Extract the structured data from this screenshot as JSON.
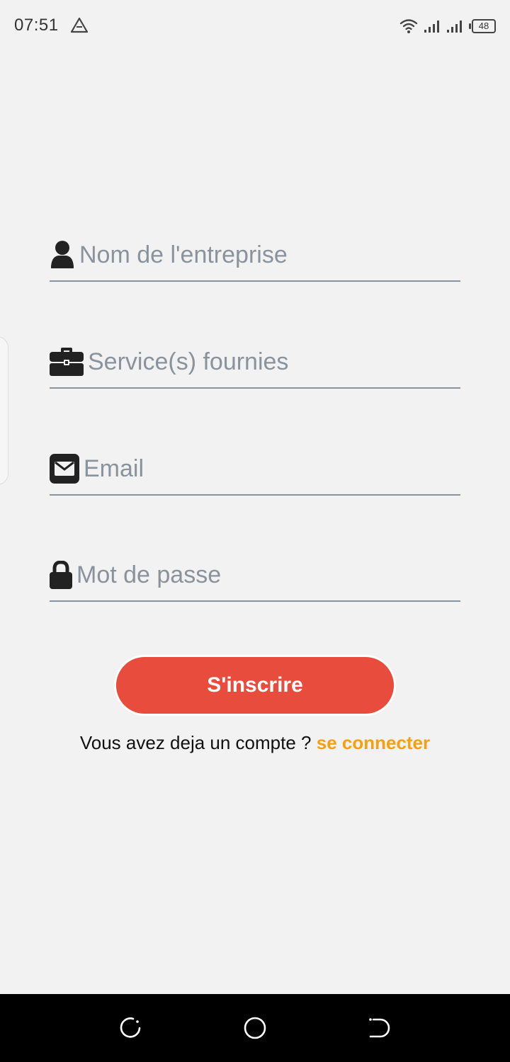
{
  "status_bar": {
    "time": "07:51",
    "battery": "48",
    "icons": [
      "warning-triangle-icon",
      "wifi-icon",
      "signal-icon",
      "signal-icon",
      "battery-icon"
    ]
  },
  "form": {
    "fields": [
      {
        "icon": "user-icon",
        "placeholder": "Nom de l'entreprise",
        "value": ""
      },
      {
        "icon": "briefcase-icon",
        "placeholder": "Service(s) fournies",
        "value": ""
      },
      {
        "icon": "envelope-icon",
        "placeholder": "Email",
        "value": ""
      },
      {
        "icon": "lock-icon",
        "placeholder": "Mot de passe",
        "value": ""
      }
    ],
    "submit_label": "S'inscrire",
    "login_prompt": "Vous avez deja un compte ? ",
    "login_link": "se connecter"
  },
  "colors": {
    "background": "#f2f2f2",
    "button": "#e74c3c",
    "link": "#f5a011",
    "placeholder": "#8a939c",
    "underline": "#8a939c"
  },
  "nav_bar": {
    "buttons": [
      "recents-icon",
      "home-icon",
      "back-icon"
    ]
  }
}
